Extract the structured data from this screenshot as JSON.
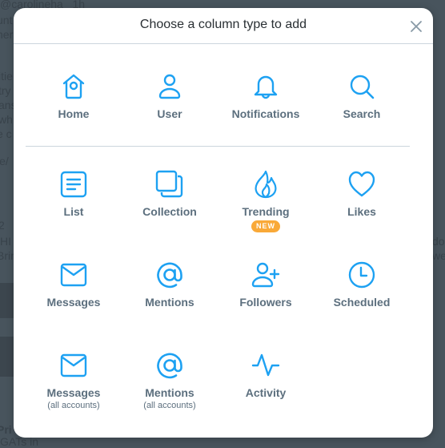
{
  "background": {
    "lines": [
      "@carolineha_ 1h",
      "unt",
      "her",
      "itie",
      "try",
      "ans",
      "wh",
      "e c",
      "le/",
      "2",
      "HI",
      "Brin",
      "Pri",
      "GATs in",
      "do",
      "we"
    ]
  },
  "modal": {
    "title": "Choose a column type to add",
    "close_icon": "close-icon"
  },
  "colors": {
    "accent": "#1da1f2",
    "label": "#5c6f7e",
    "badge": "#f9a938",
    "divider": "#ccd6dd"
  },
  "rows": [
    {
      "tiles": [
        {
          "label": "Home",
          "icon": "home-icon"
        },
        {
          "label": "User",
          "icon": "user-icon"
        },
        {
          "label": "Notifications",
          "icon": "bell-icon"
        },
        {
          "label": "Search",
          "icon": "search-icon"
        }
      ]
    },
    {
      "tiles": [
        {
          "label": "List",
          "icon": "list-icon"
        },
        {
          "label": "Collection",
          "icon": "collection-icon"
        },
        {
          "label": "Trending",
          "icon": "flame-icon",
          "badge": "NEW"
        },
        {
          "label": "Likes",
          "icon": "heart-icon"
        }
      ]
    },
    {
      "tiles": [
        {
          "label": "Messages",
          "icon": "envelope-icon"
        },
        {
          "label": "Mentions",
          "icon": "at-icon"
        },
        {
          "label": "Followers",
          "icon": "user-plus-icon"
        },
        {
          "label": "Scheduled",
          "icon": "clock-icon"
        }
      ]
    },
    {
      "tiles": [
        {
          "label": "Messages",
          "sublabel": "(all accounts)",
          "icon": "envelope-icon"
        },
        {
          "label": "Mentions",
          "sublabel": "(all accounts)",
          "icon": "at-icon"
        },
        {
          "label": "Activity",
          "icon": "activity-icon"
        }
      ]
    }
  ]
}
